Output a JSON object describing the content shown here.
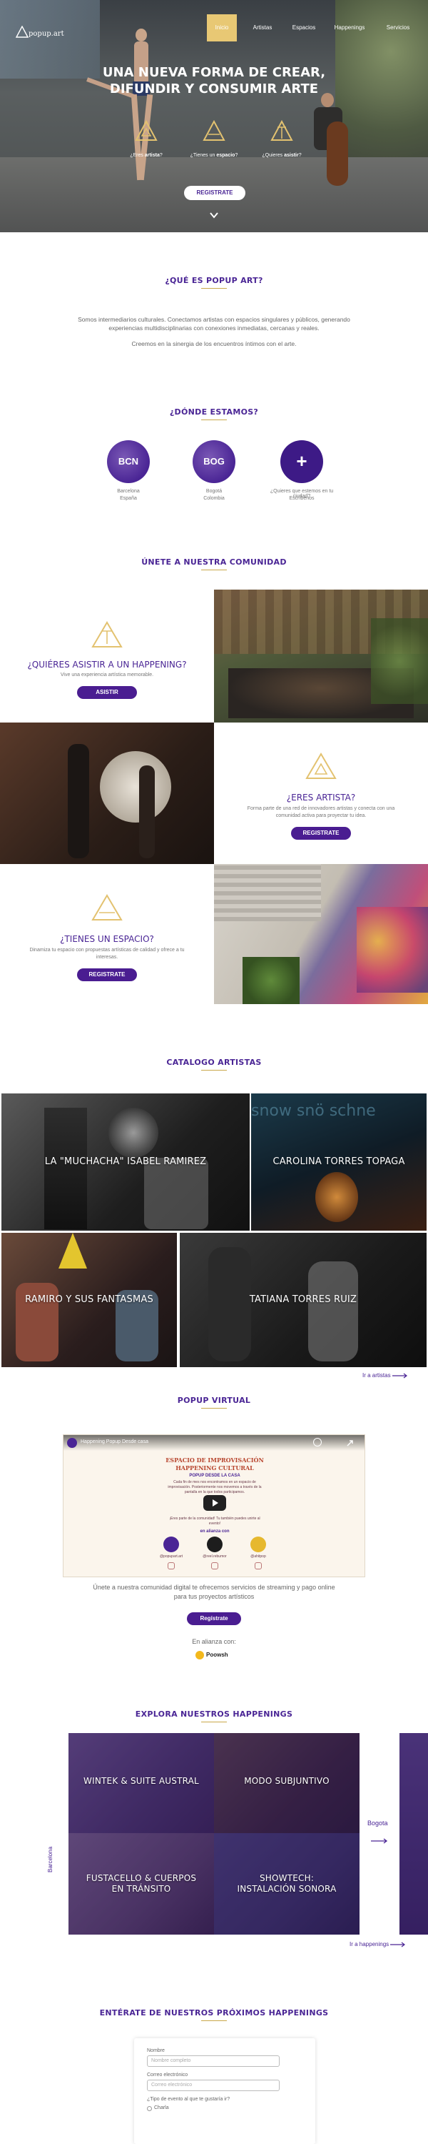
{
  "nav": {
    "logo": "popup.art",
    "items": [
      "Inicio",
      "Artistas",
      "Espacios",
      "Happenings",
      "Servicios"
    ]
  },
  "hero": {
    "title_line1": "UNA NUEVA FORMA DE CREAR,",
    "title_line2": "DIFUNDIR Y CONSUMIR ARTE",
    "items": [
      {
        "pre": "¿Eres ",
        "bold": "artista",
        "post": "?"
      },
      {
        "pre": "¿Tienes un ",
        "bold": "espacio",
        "post": "?"
      },
      {
        "pre": "¿Quieres ",
        "bold": "asistir",
        "post": "?"
      }
    ],
    "cta": "REGISTRATE"
  },
  "about": {
    "title": "¿QUÉ ES POPUP ART?",
    "text1": "Somos intermediarios culturales. Conectamos artistas con espacios singulares y públicos, generando experiencias multidisciplinarias con conexiones inmediatas, cercanas y reales.",
    "text2": "Creemos en la sinergia de los encuentros íntimos con el arte."
  },
  "where": {
    "title": "¿DÓNDE ESTAMOS?",
    "cities": [
      {
        "code": "BCN",
        "line1": "Barcelona",
        "line2": "España"
      },
      {
        "code": "BOG",
        "line1": "Bogotá",
        "line2": "Colombia"
      },
      {
        "code": "+",
        "line1": "¿Quieres que estemos en tu ciudad?",
        "line2": "Escríbenos"
      }
    ]
  },
  "community": {
    "title": "ÚNETE A NUESTRA COMUNIDAD",
    "blocks": [
      {
        "heading": "¿QUIÉRES ASISTIR A UN HAPPENING?",
        "text": "Vive una experiencia artística memorable.",
        "cta": "ASISTIR"
      },
      {
        "heading": "¿ERES ARTISTA?",
        "text": "Forma parte de una red de innovadores artistas y conecta con una comunidad activa para proyectar tu idea.",
        "cta": "REGISTRATE"
      },
      {
        "heading": "¿TIENES UN ESPACIO?",
        "text": "Dinamiza tu espacio con propuestas artísticas de calidad y ofrece a tu interesas.",
        "cta": "REGISTRATE"
      }
    ]
  },
  "catalog": {
    "title": "CATALOGO ARTISTAS",
    "artists": [
      "LA \"MUCHACHA\" ISABEL RAMIREZ",
      "CAROLINA TORRES TOPAGA",
      "RAMIRO Y SUS FANTASMAS",
      "TATIANA TORRES RUIZ"
    ],
    "more": "Ir a artistas"
  },
  "virtual": {
    "title": "POPUP VIRTUAL",
    "video_title": "Happening Popup Desde casa",
    "video_lines": [
      "ESPACIO DE IMPROVISACIÓN",
      "HAPPENING CULTURAL",
      "POPUP DESDE LA CASA",
      "Cada fin de mes nos encontramos en un espacio de improvisación. Posteriormente nos movemos a través de la pantalla en la que todos participamos.",
      "¡Eres parte de la comunidad! Tu también puedes unirte al evento!",
      "en alianza con"
    ],
    "handles": [
      "@popupart.art",
      "@reel.rebumor",
      "@ahitpop"
    ],
    "text": "Únete a nuestra comunidad digital te ofrecemos servicios de streaming y pago online para tus proyectos artísticos",
    "cta": "Regístrate",
    "alliance": "En alianza con:",
    "partner": "Poowsh"
  },
  "happenings": {
    "title": "EXPLORA NUESTROS HAPPENINGS",
    "city_left": "Barcelona",
    "city_right": "Bogota",
    "items": [
      "WINTEK & SUITE AUSTRAL",
      "MODO SUBJUNTIVO",
      "FUSTACELLO & CUERPOS EN TRÁNSITO",
      "SHOWTECH: INSTALACIÓN SONORA"
    ],
    "more": "Ir a happenings"
  },
  "newsletter": {
    "title": "ENTÉRATE DE NUESTROS PRÓXIMOS HAPPENINGS",
    "name_label": "Nombre",
    "name_ph": "Nombre completo",
    "email_label": "Correo electrónico",
    "email_ph": "Correo electrónico",
    "type_label": "¿Tipo de evento al que te gustaría ir?",
    "option": "Charla"
  }
}
